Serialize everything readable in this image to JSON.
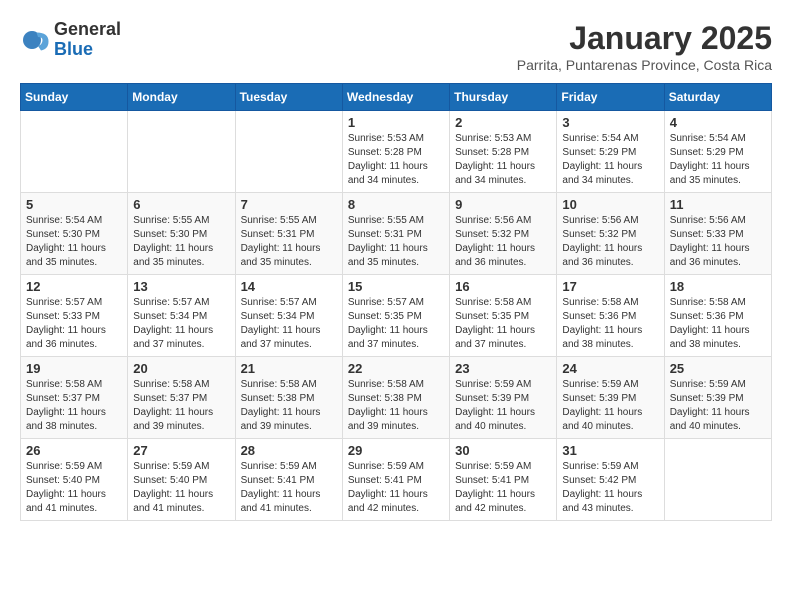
{
  "header": {
    "logo_general": "General",
    "logo_blue": "Blue",
    "month_title": "January 2025",
    "subtitle": "Parrita, Puntarenas Province, Costa Rica"
  },
  "weekdays": [
    "Sunday",
    "Monday",
    "Tuesday",
    "Wednesday",
    "Thursday",
    "Friday",
    "Saturday"
  ],
  "weeks": [
    [
      {
        "day": "",
        "info": ""
      },
      {
        "day": "",
        "info": ""
      },
      {
        "day": "",
        "info": ""
      },
      {
        "day": "1",
        "info": "Sunrise: 5:53 AM\nSunset: 5:28 PM\nDaylight: 11 hours\nand 34 minutes."
      },
      {
        "day": "2",
        "info": "Sunrise: 5:53 AM\nSunset: 5:28 PM\nDaylight: 11 hours\nand 34 minutes."
      },
      {
        "day": "3",
        "info": "Sunrise: 5:54 AM\nSunset: 5:29 PM\nDaylight: 11 hours\nand 34 minutes."
      },
      {
        "day": "4",
        "info": "Sunrise: 5:54 AM\nSunset: 5:29 PM\nDaylight: 11 hours\nand 35 minutes."
      }
    ],
    [
      {
        "day": "5",
        "info": "Sunrise: 5:54 AM\nSunset: 5:30 PM\nDaylight: 11 hours\nand 35 minutes."
      },
      {
        "day": "6",
        "info": "Sunrise: 5:55 AM\nSunset: 5:30 PM\nDaylight: 11 hours\nand 35 minutes."
      },
      {
        "day": "7",
        "info": "Sunrise: 5:55 AM\nSunset: 5:31 PM\nDaylight: 11 hours\nand 35 minutes."
      },
      {
        "day": "8",
        "info": "Sunrise: 5:55 AM\nSunset: 5:31 PM\nDaylight: 11 hours\nand 35 minutes."
      },
      {
        "day": "9",
        "info": "Sunrise: 5:56 AM\nSunset: 5:32 PM\nDaylight: 11 hours\nand 36 minutes."
      },
      {
        "day": "10",
        "info": "Sunrise: 5:56 AM\nSunset: 5:32 PM\nDaylight: 11 hours\nand 36 minutes."
      },
      {
        "day": "11",
        "info": "Sunrise: 5:56 AM\nSunset: 5:33 PM\nDaylight: 11 hours\nand 36 minutes."
      }
    ],
    [
      {
        "day": "12",
        "info": "Sunrise: 5:57 AM\nSunset: 5:33 PM\nDaylight: 11 hours\nand 36 minutes."
      },
      {
        "day": "13",
        "info": "Sunrise: 5:57 AM\nSunset: 5:34 PM\nDaylight: 11 hours\nand 37 minutes."
      },
      {
        "day": "14",
        "info": "Sunrise: 5:57 AM\nSunset: 5:34 PM\nDaylight: 11 hours\nand 37 minutes."
      },
      {
        "day": "15",
        "info": "Sunrise: 5:57 AM\nSunset: 5:35 PM\nDaylight: 11 hours\nand 37 minutes."
      },
      {
        "day": "16",
        "info": "Sunrise: 5:58 AM\nSunset: 5:35 PM\nDaylight: 11 hours\nand 37 minutes."
      },
      {
        "day": "17",
        "info": "Sunrise: 5:58 AM\nSunset: 5:36 PM\nDaylight: 11 hours\nand 38 minutes."
      },
      {
        "day": "18",
        "info": "Sunrise: 5:58 AM\nSunset: 5:36 PM\nDaylight: 11 hours\nand 38 minutes."
      }
    ],
    [
      {
        "day": "19",
        "info": "Sunrise: 5:58 AM\nSunset: 5:37 PM\nDaylight: 11 hours\nand 38 minutes."
      },
      {
        "day": "20",
        "info": "Sunrise: 5:58 AM\nSunset: 5:37 PM\nDaylight: 11 hours\nand 39 minutes."
      },
      {
        "day": "21",
        "info": "Sunrise: 5:58 AM\nSunset: 5:38 PM\nDaylight: 11 hours\nand 39 minutes."
      },
      {
        "day": "22",
        "info": "Sunrise: 5:58 AM\nSunset: 5:38 PM\nDaylight: 11 hours\nand 39 minutes."
      },
      {
        "day": "23",
        "info": "Sunrise: 5:59 AM\nSunset: 5:39 PM\nDaylight: 11 hours\nand 40 minutes."
      },
      {
        "day": "24",
        "info": "Sunrise: 5:59 AM\nSunset: 5:39 PM\nDaylight: 11 hours\nand 40 minutes."
      },
      {
        "day": "25",
        "info": "Sunrise: 5:59 AM\nSunset: 5:39 PM\nDaylight: 11 hours\nand 40 minutes."
      }
    ],
    [
      {
        "day": "26",
        "info": "Sunrise: 5:59 AM\nSunset: 5:40 PM\nDaylight: 11 hours\nand 41 minutes."
      },
      {
        "day": "27",
        "info": "Sunrise: 5:59 AM\nSunset: 5:40 PM\nDaylight: 11 hours\nand 41 minutes."
      },
      {
        "day": "28",
        "info": "Sunrise: 5:59 AM\nSunset: 5:41 PM\nDaylight: 11 hours\nand 41 minutes."
      },
      {
        "day": "29",
        "info": "Sunrise: 5:59 AM\nSunset: 5:41 PM\nDaylight: 11 hours\nand 42 minutes."
      },
      {
        "day": "30",
        "info": "Sunrise: 5:59 AM\nSunset: 5:41 PM\nDaylight: 11 hours\nand 42 minutes."
      },
      {
        "day": "31",
        "info": "Sunrise: 5:59 AM\nSunset: 5:42 PM\nDaylight: 11 hours\nand 43 minutes."
      },
      {
        "day": "",
        "info": ""
      }
    ]
  ]
}
